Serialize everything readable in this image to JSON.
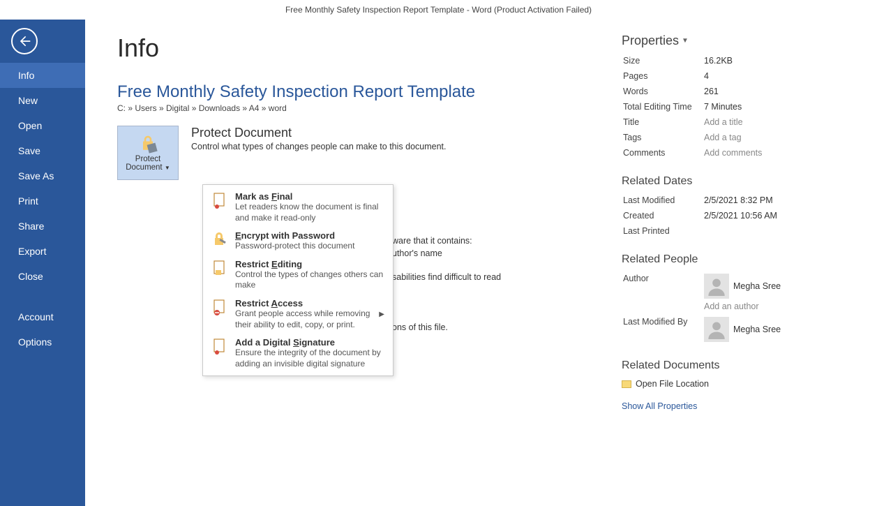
{
  "titlebar": "Free Monthly Safety Inspection Report Template - Word (Product Activation Failed)",
  "page_title": "Info",
  "doc_title": "Free Monthly Safety Inspection Report Template",
  "doc_path": "C: » Users » Digital » Downloads » A4 » word",
  "nav": {
    "info": "Info",
    "new": "New",
    "open": "Open",
    "save": "Save",
    "save_as": "Save As",
    "print": "Print",
    "share": "Share",
    "export": "Export",
    "close": "Close",
    "account": "Account",
    "options": "Options"
  },
  "protect": {
    "btn_label1": "Protect",
    "btn_label2": "Document",
    "heading": "Protect Document",
    "desc": "Control what types of changes people can make to this document."
  },
  "dropdown": {
    "mark_final": {
      "title_pre": "Mark as ",
      "title_u": "F",
      "title_post": "inal",
      "desc": "Let readers know the document is final and make it read-only"
    },
    "encrypt": {
      "title_pre": "",
      "title_u": "E",
      "title_post": "ncrypt with Password",
      "desc": "Password-protect this document"
    },
    "restrict_edit": {
      "title_pre": "Restrict ",
      "title_u": "E",
      "title_post": "diting",
      "desc": "Control the types of changes others can make"
    },
    "restrict_access": {
      "title_pre": "Restrict ",
      "title_u": "A",
      "title_post": "ccess",
      "desc": "Grant people access while removing their ability to edit, copy, or print."
    },
    "dsig": {
      "title_pre": "Add a Digital ",
      "title_u": "S",
      "title_post": "ignature",
      "desc": "Ensure the integrity of the document by adding an invisible digital signature"
    }
  },
  "bg_text": {
    "l1": "ware that it contains:",
    "l2": "uthor's name",
    "l3": "sabilities find difficult to read",
    "l4": "ons of this file."
  },
  "props": {
    "header": "Properties",
    "size_k": "Size",
    "size_v": "16.2KB",
    "pages_k": "Pages",
    "pages_v": "4",
    "words_k": "Words",
    "words_v": "261",
    "editing_k": "Total Editing Time",
    "editing_v": "7 Minutes",
    "title_k": "Title",
    "title_v": "Add a title",
    "tags_k": "Tags",
    "tags_v": "Add a tag",
    "comments_k": "Comments",
    "comments_v": "Add comments"
  },
  "dates": {
    "header": "Related Dates",
    "modified_k": "Last Modified",
    "modified_v": "2/5/2021 8:32 PM",
    "created_k": "Created",
    "created_v": "2/5/2021 10:56 AM",
    "printed_k": "Last Printed",
    "printed_v": ""
  },
  "people": {
    "header": "Related People",
    "author_k": "Author",
    "author_v": "Megha Sree",
    "add_author": "Add an author",
    "lastmod_k": "Last Modified By",
    "lastmod_v": "Megha Sree"
  },
  "docs": {
    "header": "Related Documents",
    "open_loc": "Open File Location",
    "show_all": "Show All Properties"
  }
}
